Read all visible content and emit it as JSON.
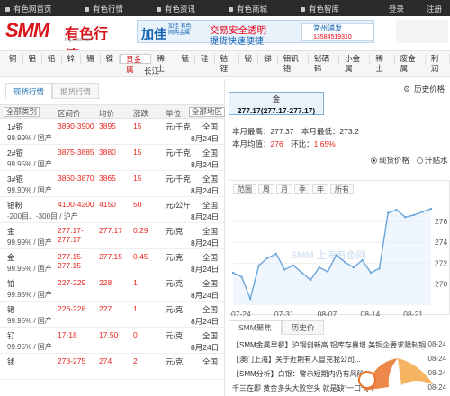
{
  "topbar": {
    "items": [
      "有色网首页",
      "有色行情",
      "有色资讯",
      "有色商城",
      "有色智库"
    ],
    "login": "登录",
    "register": "注册"
  },
  "logo": {
    "brand": "SMM",
    "cn": "有色行情",
    "url": "hq.smm.cn"
  },
  "ad": {
    "head": "加佳",
    "sub": "加佳 有色 网购金属",
    "slogan1": "交易安全透明",
    "slogan2": "提货快速便捷",
    "partner": "常州浦发",
    "phone": "13584519310"
  },
  "metals": {
    "items": [
      "铜",
      "铝",
      "铅",
      "锌",
      "锡",
      "镍",
      "贵金属",
      "稀土",
      "锰",
      "硅",
      "钴锂",
      "铋",
      "锑",
      "钼钒铬",
      "铋硒碲",
      "小金属",
      "稀土",
      "废金属",
      "利润"
    ],
    "active_index": 6,
    "second_row": "长江"
  },
  "left": {
    "tabs": [
      "现货行情",
      "期货行情"
    ],
    "headers": {
      "select_all": "全部类别",
      "range": "区间价",
      "avg": "均价",
      "change": "涨跌",
      "unit": "单位",
      "region_select": "全部地区"
    },
    "rows": [
      {
        "name": "1#银",
        "sub": "99.99% / 国产",
        "range": "3890-3900",
        "avg": "3895",
        "chg": "15",
        "unit": "元/千克",
        "region": "全国",
        "date": "8月24日"
      },
      {
        "name": "2#银",
        "sub": "99.95% / 国产",
        "range": "3875-3885",
        "avg": "3880",
        "chg": "15",
        "unit": "元/千克",
        "region": "全国",
        "date": "8月24日"
      },
      {
        "name": "3#银",
        "sub": "99.90% / 国产",
        "range": "3860-3870",
        "avg": "3865",
        "chg": "15",
        "unit": "元/千克",
        "region": "全国",
        "date": "8月24日"
      },
      {
        "name": "银粉",
        "sub": "-200目、-300目 / 沪产",
        "range": "4100-4200",
        "avg": "4150",
        "chg": "50",
        "unit": "元/公斤",
        "region": "全国",
        "date": "8月24日"
      },
      {
        "name": "金",
        "sub": "99.99% / 国产",
        "range": "277.17-277.17",
        "avg": "277.17",
        "chg": "0.29",
        "unit": "元/克",
        "region": "全国",
        "date": "8月24日"
      },
      {
        "name": "金",
        "sub": "99.95% / 国产",
        "range": "277.15-277.15",
        "avg": "277.15",
        "chg": "0.45",
        "unit": "元/克",
        "region": "全国",
        "date": "8月24日"
      },
      {
        "name": "铂",
        "sub": "99.95% / 国产",
        "range": "227-229",
        "avg": "228",
        "chg": "1",
        "unit": "元/克",
        "region": "全国",
        "date": "8月24日"
      },
      {
        "name": "钯",
        "sub": "99.95% / 国产",
        "range": "226-228",
        "avg": "227",
        "chg": "1",
        "unit": "元/克",
        "region": "全国",
        "date": "8月24日"
      },
      {
        "name": "钌",
        "sub": "99.95% / 国产",
        "range": "17-18",
        "avg": "17.50",
        "chg": "0",
        "unit": "元/克",
        "region": "全国",
        "date": "8月24日"
      },
      {
        "name": "铑",
        "sub": "",
        "range": "273-275",
        "avg": "274",
        "chg": "2",
        "unit": "元/克",
        "region": "全国",
        "date": ""
      }
    ]
  },
  "right": {
    "config_label": "历史价格",
    "quote": {
      "name": "金",
      "price": "277.17(277.17-277.17)"
    },
    "stats": {
      "high_label": "本月最高：",
      "high": "277.37",
      "low_label": "本月最低：",
      "low": "273.2",
      "avg_label": "本月均值：",
      "avg": "276",
      "mom_label": "环比：",
      "mom": "1.65%"
    },
    "radios": [
      "现货价格",
      "升贴水"
    ],
    "ranges": [
      "范围",
      "周",
      "月",
      "季",
      "年",
      "所有"
    ],
    "watermark": "SMM 上海有色网",
    "news_tabs": [
      "SMM聚焦",
      "历史价"
    ],
    "news": [
      {
        "text": "【SMM金属早餐】沪铜创新高 铝库存暴增 美铜企要求限制铜",
        "date": "08-24"
      },
      {
        "text": "【澳门上海】关于近期有人冒充我公司...",
        "date": "08-24"
      },
      {
        "text": "【SMM分析】白银：警示短期内仍有风险...",
        "date": "08-24"
      },
      {
        "text": "千三在即 黄金多头大败空头 就是缺“一口气”！",
        "date": "08-24"
      }
    ]
  },
  "colors": {
    "accent": "#1e6fb8",
    "brand": "#d7141a",
    "up": "#e6261f",
    "chart_line": "#6aa6dc"
  },
  "chart_data": {
    "type": "line",
    "x": [
      "07-24",
      "07-25",
      "07-26",
      "07-27",
      "07-28",
      "07-31",
      "08-01",
      "08-02",
      "08-03",
      "08-04",
      "08-07",
      "08-08",
      "08-09",
      "08-10",
      "08-11",
      "08-14",
      "08-15",
      "08-16",
      "08-17",
      "08-18",
      "08-21",
      "08-22",
      "08-23",
      "08-24"
    ],
    "values": [
      271.1,
      270.7,
      268.6,
      271.8,
      272.5,
      272.9,
      271.4,
      271.8,
      271.1,
      270.4,
      271.6,
      271.2,
      272.8,
      272.1,
      271.6,
      272.3,
      271.1,
      271.5,
      276.8,
      277.1,
      276.4,
      276.6,
      276.9,
      277.2
    ],
    "x_tick_labels": [
      "07-24",
      "07-31",
      "08-07",
      "08-14",
      "08-21"
    ],
    "y_tick_labels": [
      "276",
      "274",
      "272",
      "270"
    ],
    "ylim": [
      268,
      277.8
    ],
    "grid": true,
    "title": "",
    "xlabel": "",
    "ylabel": ""
  }
}
